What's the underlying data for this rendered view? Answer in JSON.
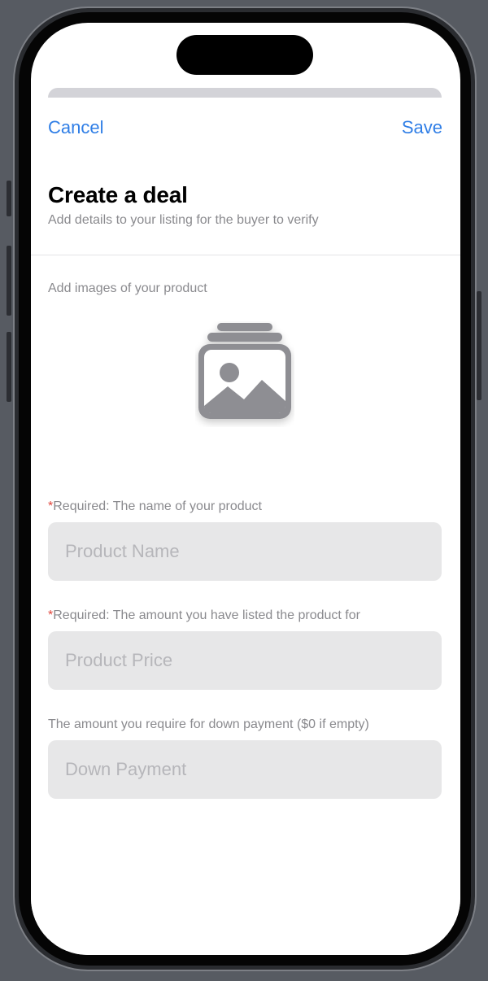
{
  "nav": {
    "cancel_label": "Cancel",
    "save_label": "Save"
  },
  "header": {
    "title": "Create a deal",
    "subtitle": "Add details to your listing for the buyer to verify"
  },
  "images_section": {
    "label": "Add images of your product",
    "icon": "photo-stack-icon"
  },
  "fields": {
    "product_name": {
      "required_mark": "*",
      "label": "Required: The name of your product",
      "placeholder": "Product Name",
      "value": ""
    },
    "product_price": {
      "required_mark": "*",
      "label": "Required: The amount you have listed the product for",
      "placeholder": "Product Price",
      "value": ""
    },
    "down_payment": {
      "label": "The amount you require for down payment ($0 if empty)",
      "placeholder": "Down Payment",
      "value": ""
    }
  },
  "colors": {
    "accent": "#2f7ee6",
    "required": "#e0443a",
    "secondary_text": "#8a8a8e",
    "field_background": "#e7e7e8"
  }
}
